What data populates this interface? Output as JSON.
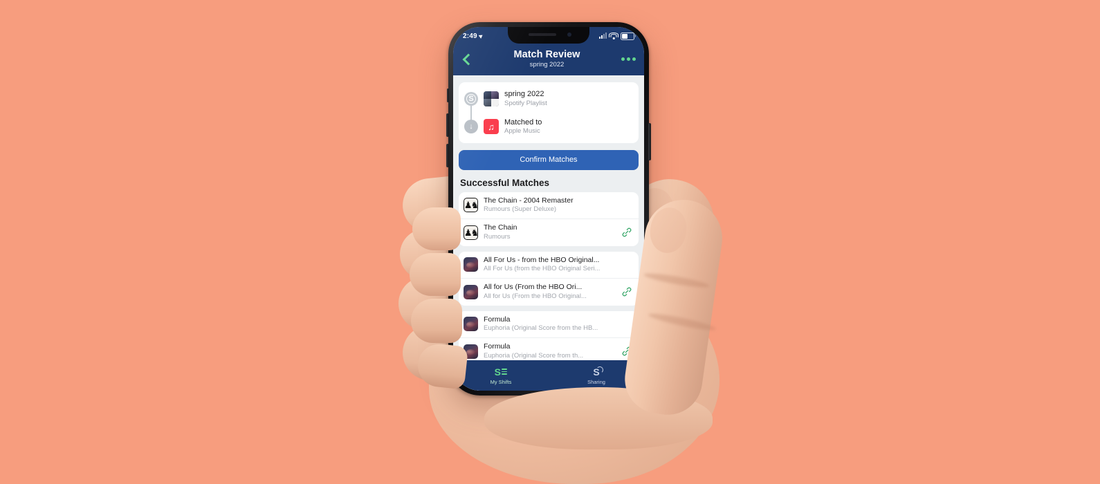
{
  "background_color": "#f79d7e",
  "phone": {
    "status_bar": {
      "time": "2:49",
      "location_icon": "location-arrow-icon",
      "signal_icon": "cellular-bars-icon",
      "wifi_icon": "wifi-icon",
      "battery_icon": "battery-icon"
    },
    "nav": {
      "back_icon": "chevron-left-icon",
      "title": "Match Review",
      "subtitle": "spring 2022",
      "more_icon": "more-options-icon"
    },
    "accent_green": "#63d68f",
    "navbar_color": "#1d3a6e"
  },
  "source_card": {
    "rows": [
      {
        "step_icon": "spotify-badge-icon",
        "art": "playlist-artwork",
        "title": "spring 2022",
        "subtitle": "Spotify Playlist"
      },
      {
        "step_icon": "arrow-down-circle-icon",
        "art": "apple-music-icon",
        "title": "Matched to",
        "subtitle": "Apple Music"
      }
    ]
  },
  "confirm_button": {
    "label": "Confirm Matches",
    "color": "#2f63b5"
  },
  "section": {
    "title": "Successful Matches",
    "link_icon_color": "#3aa86b"
  },
  "matches": [
    {
      "artwork": "rumours-album-art",
      "source": {
        "title": "The Chain - 2004 Remaster",
        "subtitle": "Rumours (Super Deluxe)",
        "linked": false
      },
      "target": {
        "title": "The Chain",
        "subtitle": "Rumours",
        "linked": true,
        "link_icon": "link-chain-icon"
      }
    },
    {
      "artwork": "euphoria-album-art",
      "source": {
        "title": "All For Us - from the HBO Original...",
        "subtitle": "All For Us (from the HBO Original Seri...",
        "linked": false
      },
      "target": {
        "title": "All for Us (From the HBO Ori...",
        "subtitle": "All for Us (From the HBO Original...",
        "linked": true,
        "link_icon": "link-chain-icon"
      }
    },
    {
      "artwork": "euphoria-album-art",
      "source": {
        "title": "Formula",
        "subtitle": "Euphoria (Original Score from the HB...",
        "linked": false
      },
      "target": {
        "title": "Formula",
        "subtitle": "Euphoria (Original Score from th...",
        "linked": true,
        "link_icon": "link-chain-icon"
      }
    }
  ],
  "tabbar": {
    "tabs": [
      {
        "label": "My Shifts",
        "icon": "shifts-s-icon",
        "active": true
      },
      {
        "label": "Sharing",
        "icon": "sharing-s-icon",
        "active": false
      }
    ]
  }
}
